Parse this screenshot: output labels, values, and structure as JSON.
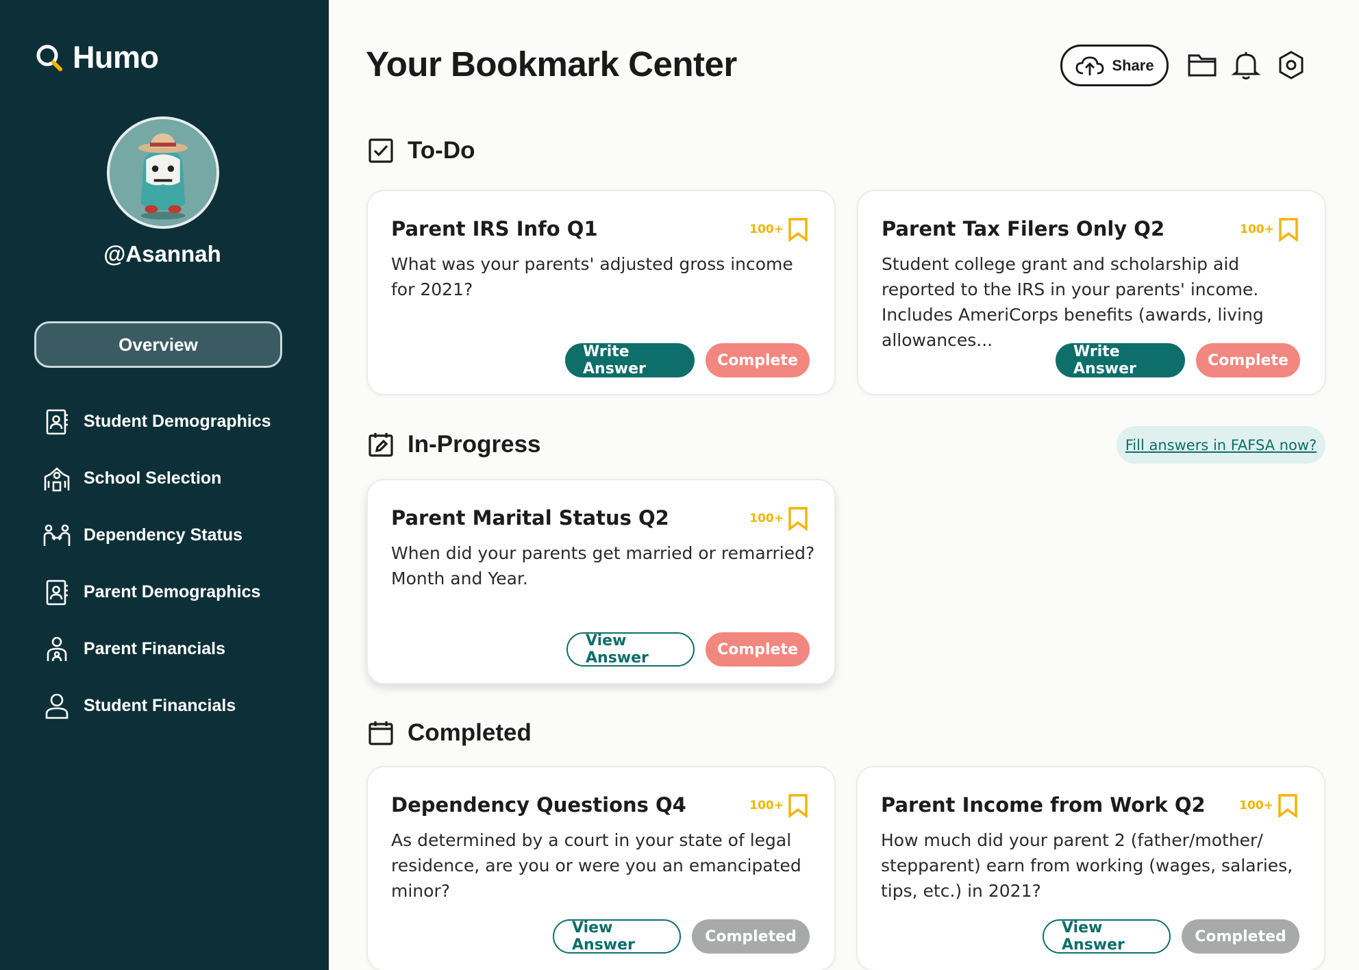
{
  "brand": {
    "name": "Humo"
  },
  "user": {
    "handle": "@Asannah"
  },
  "sidebar": {
    "overview_label": "Overview",
    "items": [
      {
        "label": "Student Demographics",
        "icon": "contact-book-icon"
      },
      {
        "label": "School Selection",
        "icon": "school-icon"
      },
      {
        "label": "Dependency Status",
        "icon": "family-icon"
      },
      {
        "label": "Parent Demographics",
        "icon": "contact-book-icon"
      },
      {
        "label": "Parent Financials",
        "icon": "parent-child-icon"
      },
      {
        "label": "Student Financials",
        "icon": "person-icon"
      }
    ]
  },
  "header": {
    "title": "Your Bookmark Center",
    "share_label": "Share"
  },
  "sections": {
    "todo": {
      "title": "To-Do"
    },
    "in_progress": {
      "title": "In-Progress",
      "fafsa_link": "Fill answers in FAFSA now?"
    },
    "completed": {
      "title": "Completed"
    }
  },
  "cards": {
    "todo": [
      {
        "title": "Parent IRS Info Q1",
        "count": "100+",
        "text": "What was your parents' adjusted gross income for 2021?",
        "primary": "Write Answer",
        "secondary": "Complete"
      },
      {
        "title": "Parent Tax Filers Only Q2",
        "count": "100+",
        "text": "Student college grant and scholarship aid reported to the IRS in your parents' income. Includes AmeriCorps benefits (awards, living allowances...",
        "primary": "Write Answer",
        "secondary": "Complete"
      }
    ],
    "in_progress": [
      {
        "title": "Parent Marital Status Q2",
        "count": "100+",
        "text": "When did your parents get married or remarried? Month and Year.",
        "primary": "View Answer",
        "secondary": "Complete"
      }
    ],
    "completed": [
      {
        "title": "Dependency Questions Q4",
        "count": "100+",
        "text": "As determined by a court in your state of legal residence, are you or were you an emancipated minor?",
        "primary": "View Answer",
        "secondary": "Completed"
      },
      {
        "title": "Parent Income from Work Q2",
        "count": "100+",
        "text": "How much did your parent 2 (father/mother/ stepparent) earn from working (wages, salaries, tips, etc.) in 2021?",
        "primary": "View Answer",
        "secondary": "Completed"
      }
    ]
  },
  "colors": {
    "sidebar_bg": "#0d3038",
    "teal": "#0d6e6a",
    "coral": "#f2877f",
    "bookmark": "#f2b400",
    "disabled": "#a7aaa9"
  }
}
